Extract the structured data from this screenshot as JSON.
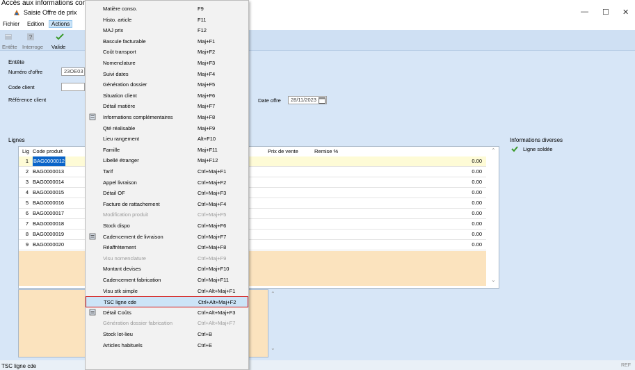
{
  "caption": "Accès aux informations complémentaires de la ligne d'offre de prix",
  "window": {
    "title": "Saisie Offre de prix",
    "minimize": "—",
    "maximize": "☐",
    "close": "✕"
  },
  "menubar": {
    "items": [
      "Fichier",
      "Edition",
      "Actions"
    ]
  },
  "toolbar": {
    "items": [
      "Entête",
      "Interroge",
      "Valide"
    ]
  },
  "header": {
    "section": "Entête",
    "offer_number_label": "Numéro d'offre",
    "offer_number_value": "23OE03",
    "client_code_label": "Code client",
    "client_ref_label": "Référence client",
    "date_label": "Date offre",
    "date_value": "28/11/2023"
  },
  "lines": {
    "section": "Lignes",
    "columns": [
      "Lig",
      "Code produit",
      "Prix de vente",
      "Remise %"
    ],
    "rows": [
      {
        "num": "1",
        "code": "BAG0000012",
        "value": "0.00"
      },
      {
        "num": "2",
        "code": "BAG0000013",
        "value": "0.00"
      },
      {
        "num": "3",
        "code": "BAG0000014",
        "value": "0.00"
      },
      {
        "num": "4",
        "code": "BAG0000015",
        "value": "0.00"
      },
      {
        "num": "5",
        "code": "BAG0000016",
        "value": "0.00"
      },
      {
        "num": "6",
        "code": "BAG0000017",
        "value": "0.00"
      },
      {
        "num": "7",
        "code": "BAG0000018",
        "value": "0.00"
      },
      {
        "num": "8",
        "code": "BAG0000019",
        "value": "0.00"
      },
      {
        "num": "9",
        "code": "BAG0000020",
        "value": "0.00"
      }
    ]
  },
  "info": {
    "section": "Informations diverses",
    "status": "Ligne soldée"
  },
  "statusbar": {
    "left": "TSC ligne cde",
    "right": "REF"
  },
  "context_menu": {
    "items": [
      {
        "label": "Matière conso.",
        "shortcut": "F9",
        "disabled": false
      },
      {
        "label": "Histo. article",
        "shortcut": "F11",
        "disabled": false
      },
      {
        "label": "MAJ prix",
        "shortcut": "F12",
        "disabled": false
      },
      {
        "label": "Bascule facturable",
        "shortcut": "Maj+F1",
        "disabled": false
      },
      {
        "label": "Coût transport",
        "shortcut": "Maj+F2",
        "disabled": false
      },
      {
        "label": "Nomenclature",
        "shortcut": "Maj+F3",
        "disabled": false
      },
      {
        "label": "Suivi dates",
        "shortcut": "Maj+F4",
        "disabled": false
      },
      {
        "label": "Génération dossier",
        "shortcut": "Maj+F5",
        "disabled": false
      },
      {
        "label": "Situation client",
        "shortcut": "Maj+F6",
        "disabled": false
      },
      {
        "label": "Détail matière",
        "shortcut": "Maj+F7",
        "disabled": false
      },
      {
        "label": "Informations complémentaires",
        "shortcut": "Maj+F8",
        "disabled": false
      },
      {
        "label": "Qté réalisable",
        "shortcut": "Maj+F9",
        "disabled": false
      },
      {
        "label": "Lieu rangement",
        "shortcut": "Alt+F10",
        "disabled": false
      },
      {
        "label": "Famille",
        "shortcut": "Maj+F11",
        "disabled": false
      },
      {
        "label": "Libellé étranger",
        "shortcut": "Maj+F12",
        "disabled": false
      },
      {
        "label": "Tarif",
        "shortcut": "Ctrl+Maj+F1",
        "disabled": false
      },
      {
        "label": "Appel livraison",
        "shortcut": "Ctrl+Maj+F2",
        "disabled": false
      },
      {
        "label": "Détail OF",
        "shortcut": "Ctrl+Maj+F3",
        "disabled": false
      },
      {
        "label": "Facture de rattachement",
        "shortcut": "Ctrl+Maj+F4",
        "disabled": false
      },
      {
        "label": "Modification produit",
        "shortcut": "Ctrl+Maj+F5",
        "disabled": true
      },
      {
        "label": "Stock dispo",
        "shortcut": "Ctrl+Maj+F6",
        "disabled": false
      },
      {
        "label": "Cadencement de livraison",
        "shortcut": "Ctrl+Maj+F7",
        "disabled": false
      },
      {
        "label": "Réaffrètement",
        "shortcut": "Ctrl+Maj+F8",
        "disabled": false
      },
      {
        "label": "Visu nomenclature",
        "shortcut": "Ctrl+Maj+F9",
        "disabled": true
      },
      {
        "label": "Montant devises",
        "shortcut": "Ctrl+Maj+F10",
        "disabled": false
      },
      {
        "label": "Cadencement fabrication",
        "shortcut": "Ctrl+Maj+F11",
        "disabled": false
      },
      {
        "label": "Visu stk simple",
        "shortcut": "Ctrl+Alt+Maj+F1",
        "disabled": false
      },
      {
        "label": "TSC ligne cde",
        "shortcut": "Ctrl+Alt+Maj+F2",
        "disabled": false
      },
      {
        "label": "Détail Coûts",
        "shortcut": "Ctrl+Alt+Maj+F3",
        "disabled": false
      },
      {
        "label": "Génération dossier fabrication",
        "shortcut": "Ctrl+Alt+Maj+F7",
        "disabled": true
      },
      {
        "label": "Stock lot-lieu",
        "shortcut": "Ctrl+B",
        "disabled": false
      },
      {
        "label": "Articles habituels",
        "shortcut": "Ctrl+E",
        "disabled": false
      }
    ]
  }
}
